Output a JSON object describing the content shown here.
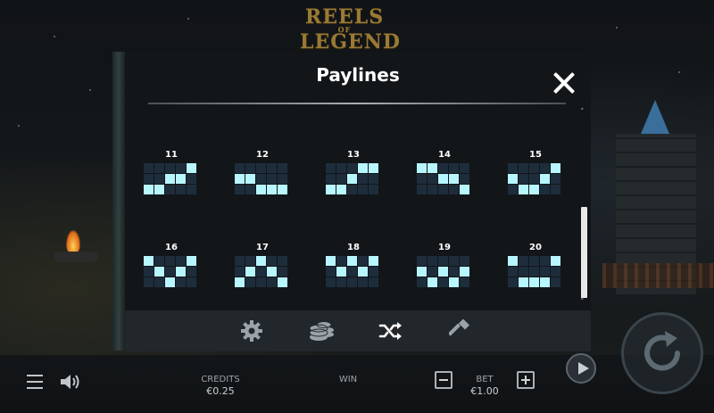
{
  "game": {
    "logo_line1": "REELS",
    "logo_of": "OF",
    "logo_line2": "LEGEND"
  },
  "paylines_panel": {
    "title": "Paylines",
    "close_icon": "close-icon",
    "lines": [
      {
        "number": "11",
        "pattern": [
          2,
          2,
          1,
          1,
          0
        ]
      },
      {
        "number": "12",
        "pattern": [
          1,
          1,
          2,
          2,
          2
        ]
      },
      {
        "number": "13",
        "pattern": [
          2,
          2,
          1,
          0,
          0
        ]
      },
      {
        "number": "14",
        "pattern": [
          0,
          0,
          1,
          1,
          2
        ]
      },
      {
        "number": "15",
        "pattern": [
          1,
          2,
          2,
          1,
          0
        ]
      },
      {
        "number": "16",
        "pattern": [
          0,
          1,
          2,
          1,
          0
        ]
      },
      {
        "number": "17",
        "pattern": [
          2,
          1,
          0,
          1,
          2
        ]
      },
      {
        "number": "18",
        "pattern": [
          0,
          1,
          0,
          1,
          0
        ]
      },
      {
        "number": "19",
        "pattern": [
          1,
          2,
          1,
          2,
          1
        ]
      },
      {
        "number": "20",
        "pattern": [
          0,
          2,
          2,
          2,
          0
        ]
      }
    ],
    "scroll_up_glyph": "˄",
    "scroll_down_glyph": "˅"
  },
  "settings_tabs": [
    {
      "icon": "gear-icon",
      "active": false
    },
    {
      "icon": "coins-icon",
      "active": false
    },
    {
      "icon": "shuffle-icon",
      "active": true
    },
    {
      "icon": "hammer-icon",
      "active": false
    }
  ],
  "bottom_bar": {
    "credits_label": "CREDITS",
    "credits_value": "€0.25",
    "win_label": "WIN",
    "win_value": "",
    "bet_label": "BET",
    "bet_value": "€1.00"
  },
  "colors": {
    "line_on": "#b8f6ff",
    "line_off": "#1e2d3c"
  }
}
